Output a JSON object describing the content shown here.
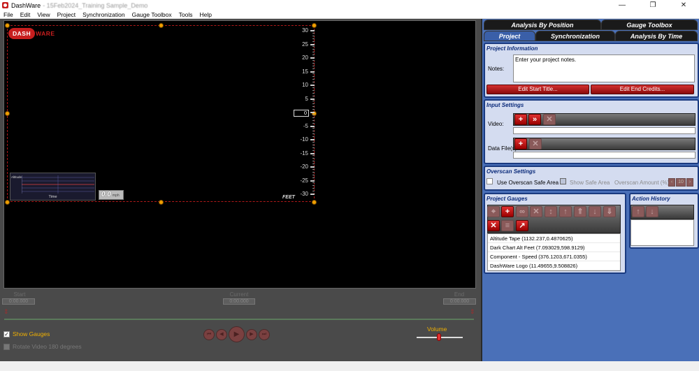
{
  "window": {
    "app_name": "DashWare",
    "file_name": " - 15Feb2024_Training Sample_Demo",
    "controls": [
      "—",
      "❐",
      "✕"
    ]
  },
  "menu": [
    "File",
    "Edit",
    "View",
    "Project",
    "Synchronization",
    "Gauge Toolbox",
    "Tools",
    "Help"
  ],
  "canvas": {
    "logo_dash": "DASH",
    "logo_ware": "WARE",
    "altitude_ticks": [
      "30",
      "25",
      "20",
      "15",
      "10",
      "5",
      "0",
      "-5",
      "-10",
      "-15",
      "-20",
      "-25",
      "-30"
    ],
    "altitude_readout": "0",
    "altitude_unit": "FEET",
    "dark_chart_xlabel": "Time",
    "dark_chart_ylabel": "Altitude",
    "speed_value": "0.0",
    "speed_unit": "mph"
  },
  "timeline": {
    "start_label": "Start",
    "start_value": "0:00.000",
    "current_label": "Current",
    "current_value": "0:00.000",
    "end_label": "End",
    "end_value": "0:00.000",
    "marker": "⇕"
  },
  "playback": {
    "show_gauges_label": "Show Gauges",
    "show_gauges_checked": "✓",
    "rotate_label": "Rotate Video 180 degrees",
    "volume_label": "Volume",
    "volume_level": 0.45,
    "buttons": [
      "⏮",
      "◀",
      "▶",
      "▶",
      "⏭"
    ]
  },
  "tabs": {
    "top": [
      "Analysis By Position",
      "Gauge Toolbox"
    ],
    "bottom": [
      "Project",
      "Synchronization",
      "Analysis By Time"
    ]
  },
  "project_info": {
    "title": "Project Information",
    "notes_label": "Notes:",
    "notes_placeholder": "Enter your project notes.",
    "start_title_button": "Edit Start Title...",
    "end_credits_button": "Edit End Credits..."
  },
  "input_settings": {
    "title": "Input Settings",
    "video_label": "Video:",
    "data_files_label": "Data File(s):"
  },
  "overscan": {
    "title": "Overscan Settings",
    "use_safe_area_label": "Use Overscan Safe Area",
    "show_safe_area_label": "Show Safe Area",
    "amount_label": "Overscan Amount (%):",
    "amount_value": "10"
  },
  "project_gauges": {
    "title": "Project Gauges",
    "items": [
      "Altitude Tape (1132.237,0.4870625)",
      "Dark Chart Alt Feet (7.093029,598.9129)",
      "Component - Speed (376.1203,671.0355)",
      "DashWare Logo (11.49655,9.508826)"
    ]
  },
  "action_history": {
    "title": "Action History"
  }
}
